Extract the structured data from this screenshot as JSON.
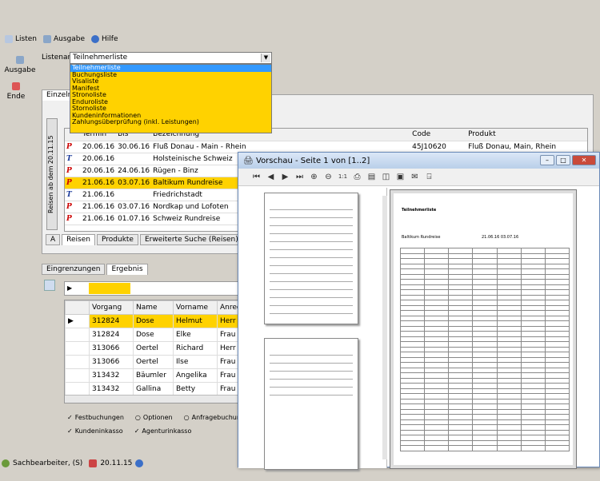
{
  "menu": {
    "listen": "Listen",
    "ausgabe": "Ausgabe",
    "hilfe": "Hilfe"
  },
  "sidebar": {
    "ausgabe": "Ausgabe",
    "ende": "Ende"
  },
  "listenart": {
    "label": "Listenart",
    "value": "Teilnehmerliste",
    "options": [
      "Teilnehmerliste",
      "Buchungsliste",
      "Visaliste",
      "Manifest",
      "Stronoliste",
      "Enduroliste",
      "Stornoliste",
      "Kundeninformationen",
      "Zahlungsüberprüfung (inkl. Leistungen)"
    ]
  },
  "main_tabs": {
    "einzelne": "Einzelne"
  },
  "vertical_tab": "Reisen ab dem 20.11.15",
  "trips": {
    "headers": [
      "Termin",
      "Bis",
      "Bezeichnung",
      "Code",
      "Produkt"
    ],
    "rows": [
      {
        "letter": "P",
        "color": "red",
        "termin": "20.06.16",
        "bis": "30.06.16",
        "bez": "Fluß Donau - Main - Rhein",
        "code": "45J10620",
        "produkt": "Fluß Donau, Main, Rhein"
      },
      {
        "letter": "T",
        "color": "blue",
        "termin": "20.06.16",
        "bis": "",
        "bez": "Holsteinische Schweiz",
        "code": "",
        "produkt": ""
      },
      {
        "letter": "P",
        "color": "red",
        "termin": "20.06.16",
        "bis": "24.06.16",
        "bez": "Rügen - Binz",
        "code": "",
        "produkt": ""
      },
      {
        "letter": "P",
        "color": "red",
        "termin": "21.06.16",
        "bis": "03.07.16",
        "bez": "Baltikum Rundreise",
        "code": "",
        "produkt": ""
      },
      {
        "letter": "T",
        "color": "blue",
        "termin": "21.06.16",
        "bis": "",
        "bez": "Friedrichstadt",
        "code": "",
        "produkt": ""
      },
      {
        "letter": "P",
        "color": "red",
        "termin": "21.06.16",
        "bis": "03.07.16",
        "bez": "Nordkap und Lofoten",
        "code": "",
        "produkt": ""
      },
      {
        "letter": "P",
        "color": "red",
        "termin": "21.06.16",
        "bis": "01.07.16",
        "bez": "Schweiz Rundreise",
        "code": "",
        "produkt": ""
      }
    ]
  },
  "bottom_tabs": {
    "a": "A",
    "reisen": "Reisen",
    "produkte": "Produkte",
    "suche": "Erweiterte Suche (Reisen)"
  },
  "lower_tabs": {
    "eingrenzungen": "Eingrenzungen",
    "ergebnis": "Ergebnis"
  },
  "results": {
    "headers": [
      "Vorgang",
      "Name",
      "Vorname",
      "Anred"
    ],
    "rows": [
      {
        "vorgang": "312824",
        "name": "Dose",
        "vorname": "Helmut",
        "anrede": "Herr"
      },
      {
        "vorgang": "312824",
        "name": "Dose",
        "vorname": "Elke",
        "anrede": "Frau"
      },
      {
        "vorgang": "313066",
        "name": "Oertel",
        "vorname": "Richard",
        "anrede": "Herr"
      },
      {
        "vorgang": "313066",
        "name": "Oertel",
        "vorname": "Ilse",
        "anrede": "Frau"
      },
      {
        "vorgang": "313432",
        "name": "Bäumler",
        "vorname": "Angelika",
        "anrede": "Frau"
      },
      {
        "vorgang": "313432",
        "name": "Gallina",
        "vorname": "Betty",
        "anrede": "Frau"
      }
    ]
  },
  "checks": {
    "fest": "Festbuchungen",
    "optionen": "Optionen",
    "anfrage": "Anfragebuchung",
    "kunden": "Kundeninkasso",
    "agentur": "Agenturinkasso"
  },
  "preview": {
    "title": "Vorschau - Seite 1 von [1..2]",
    "page_title": "Teilnehmerliste",
    "sub": "Baltikum Rundreise",
    "dates": "21.06.16   03.07.16"
  },
  "status": {
    "user": "Sachbearbeiter, (S)",
    "date": "20.11.15"
  }
}
